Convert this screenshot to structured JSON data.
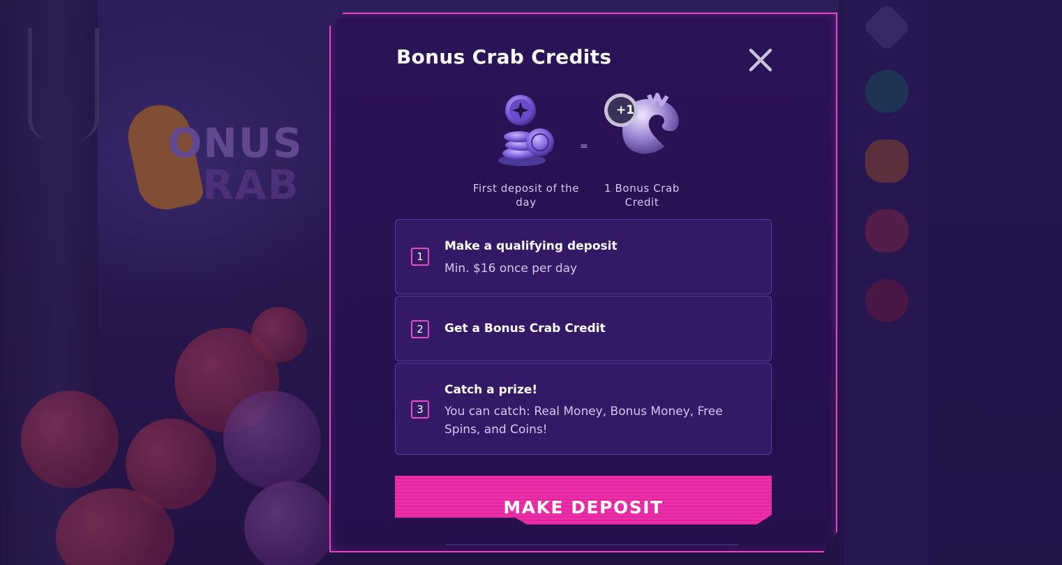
{
  "background": {
    "logo_text_line1": "ONUS",
    "logo_text_line2": "RAB"
  },
  "modal": {
    "title": "Bonus Crab Credits",
    "close_icon": "close-icon",
    "exchange": {
      "left_caption": "First deposit of the day",
      "equals": "=",
      "right_caption": "1 Bonus Crab Credit",
      "credit_badge": "+1"
    },
    "steps": [
      {
        "number": "1",
        "title": "Make a qualifying deposit",
        "description": "Min. $16 once per day"
      },
      {
        "number": "2",
        "title": "Get a Bonus Crab Credit",
        "description": ""
      },
      {
        "number": "3",
        "title": "Catch a prize!",
        "description": "You can catch: Real Money, Bonus Money, Free Spins, and Coins!"
      }
    ],
    "cta_label": "MAKE DEPOSIT"
  },
  "colors": {
    "accent": "#e844c8",
    "cta": "#ec2fa8",
    "modal_bg": "#2b1357",
    "step_bg": "#341a66"
  }
}
